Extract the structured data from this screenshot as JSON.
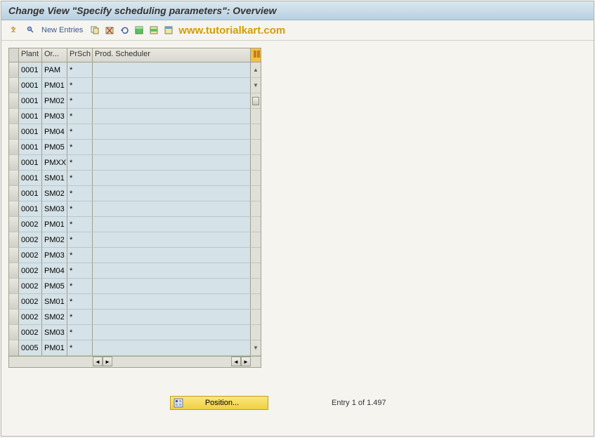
{
  "title": "Change View \"Specify scheduling parameters\": Overview",
  "toolbar": {
    "new_entries": "New Entries"
  },
  "watermark": "www.tutorialkart.com",
  "table": {
    "headers": {
      "plant": "Plant",
      "or": "Or...",
      "prsch": "PrSch",
      "prod": "Prod. Scheduler"
    },
    "rows": [
      {
        "plant": "0001",
        "or": "PAM",
        "prsch": "*",
        "prod": ""
      },
      {
        "plant": "0001",
        "or": "PM01",
        "prsch": "*",
        "prod": ""
      },
      {
        "plant": "0001",
        "or": "PM02",
        "prsch": "*",
        "prod": ""
      },
      {
        "plant": "0001",
        "or": "PM03",
        "prsch": "*",
        "prod": ""
      },
      {
        "plant": "0001",
        "or": "PM04",
        "prsch": "*",
        "prod": ""
      },
      {
        "plant": "0001",
        "or": "PM05",
        "prsch": "*",
        "prod": ""
      },
      {
        "plant": "0001",
        "or": "PMXX",
        "prsch": "*",
        "prod": ""
      },
      {
        "plant": "0001",
        "or": "SM01",
        "prsch": "*",
        "prod": ""
      },
      {
        "plant": "0001",
        "or": "SM02",
        "prsch": "*",
        "prod": ""
      },
      {
        "plant": "0001",
        "or": "SM03",
        "prsch": "*",
        "prod": ""
      },
      {
        "plant": "0002",
        "or": "PM01",
        "prsch": "*",
        "prod": ""
      },
      {
        "plant": "0002",
        "or": "PM02",
        "prsch": "*",
        "prod": ""
      },
      {
        "plant": "0002",
        "or": "PM03",
        "prsch": "*",
        "prod": ""
      },
      {
        "plant": "0002",
        "or": "PM04",
        "prsch": "*",
        "prod": ""
      },
      {
        "plant": "0002",
        "or": "PM05",
        "prsch": "*",
        "prod": ""
      },
      {
        "plant": "0002",
        "or": "SM01",
        "prsch": "*",
        "prod": ""
      },
      {
        "plant": "0002",
        "or": "SM02",
        "prsch": "*",
        "prod": ""
      },
      {
        "plant": "0002",
        "or": "SM03",
        "prsch": "*",
        "prod": ""
      },
      {
        "plant": "0005",
        "or": "PM01",
        "prsch": "*",
        "prod": ""
      }
    ]
  },
  "footer": {
    "position_label": "Position...",
    "entry_text": "Entry 1 of 1.497"
  }
}
